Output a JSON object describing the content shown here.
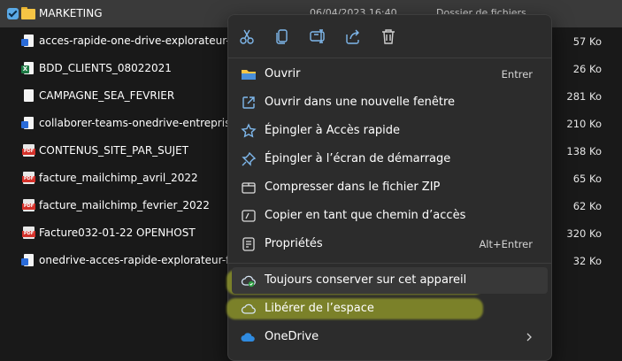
{
  "files": [
    {
      "name": "MARKETING",
      "type": "folder",
      "date": "06/04/2023 16:40",
      "kind": "Dossier de fichiers",
      "size": "",
      "selected": true
    },
    {
      "name": "acces-rapide-one-drive-explorateur-fi...",
      "type": "doc",
      "size": "57 Ko"
    },
    {
      "name": "BDD_CLIENTS_08022021",
      "type": "xlsx",
      "size": "26 Ko"
    },
    {
      "name": "CAMPAGNE_SEA_FEVRIER",
      "type": "blank",
      "size": "281 Ko"
    },
    {
      "name": "collaborer-teams-onedrive-entreprise....",
      "type": "doc",
      "size": "210 Ko"
    },
    {
      "name": "CONTENUS_SITE_PAR_SUJET",
      "type": "pdf",
      "size": "138 Ko"
    },
    {
      "name": "facture_mailchimp_avril_2022",
      "type": "pdf",
      "size": "65 Ko"
    },
    {
      "name": "facture_mailchimp_fevrier_2022",
      "type": "pdf",
      "size": "62 Ko"
    },
    {
      "name": "Facture032-01-22 OPENHOST",
      "type": "pdf",
      "size": "320 Ko"
    },
    {
      "name": "onedrive-acces-rapide-explorateur-fic...",
      "type": "doc",
      "size": "32 Ko"
    }
  ],
  "toolbar": {
    "buttons": [
      "cut-icon",
      "copy-icon",
      "rename-icon",
      "share-icon",
      "delete-icon"
    ]
  },
  "menu": {
    "items": [
      {
        "label": "Ouvrir",
        "shortcut": "Entrer",
        "icon": "folder-open-icon"
      },
      {
        "label": "Ouvrir dans une nouvelle fenêtre",
        "shortcut": "",
        "icon": "open-new-window-icon"
      },
      {
        "label": "Épingler à Accès rapide",
        "shortcut": "",
        "icon": "pin-star-icon"
      },
      {
        "label": "Épingler à l’écran de démarrage",
        "shortcut": "",
        "icon": "pin-icon"
      },
      {
        "label": "Compresser dans le fichier ZIP",
        "shortcut": "",
        "icon": "zip-icon"
      },
      {
        "label": "Copier en tant que chemin d’accès",
        "shortcut": "",
        "icon": "copy-path-icon"
      },
      {
        "label": "Propriétés",
        "shortcut": "Alt+Entrer",
        "icon": "properties-icon"
      }
    ],
    "onedrive_items": [
      {
        "label": "Toujours conserver sur cet appareil",
        "icon": "cloud-check-icon"
      },
      {
        "label": "Libérer de l’espace",
        "icon": "cloud-icon"
      }
    ],
    "onedrive_submenu": {
      "label": "OneDrive",
      "icon": "onedrive-icon"
    }
  },
  "colors": {
    "accent": "#5aa9e6",
    "highlighter": "#c8d02a",
    "menu_bg": "#2c2c2c"
  }
}
